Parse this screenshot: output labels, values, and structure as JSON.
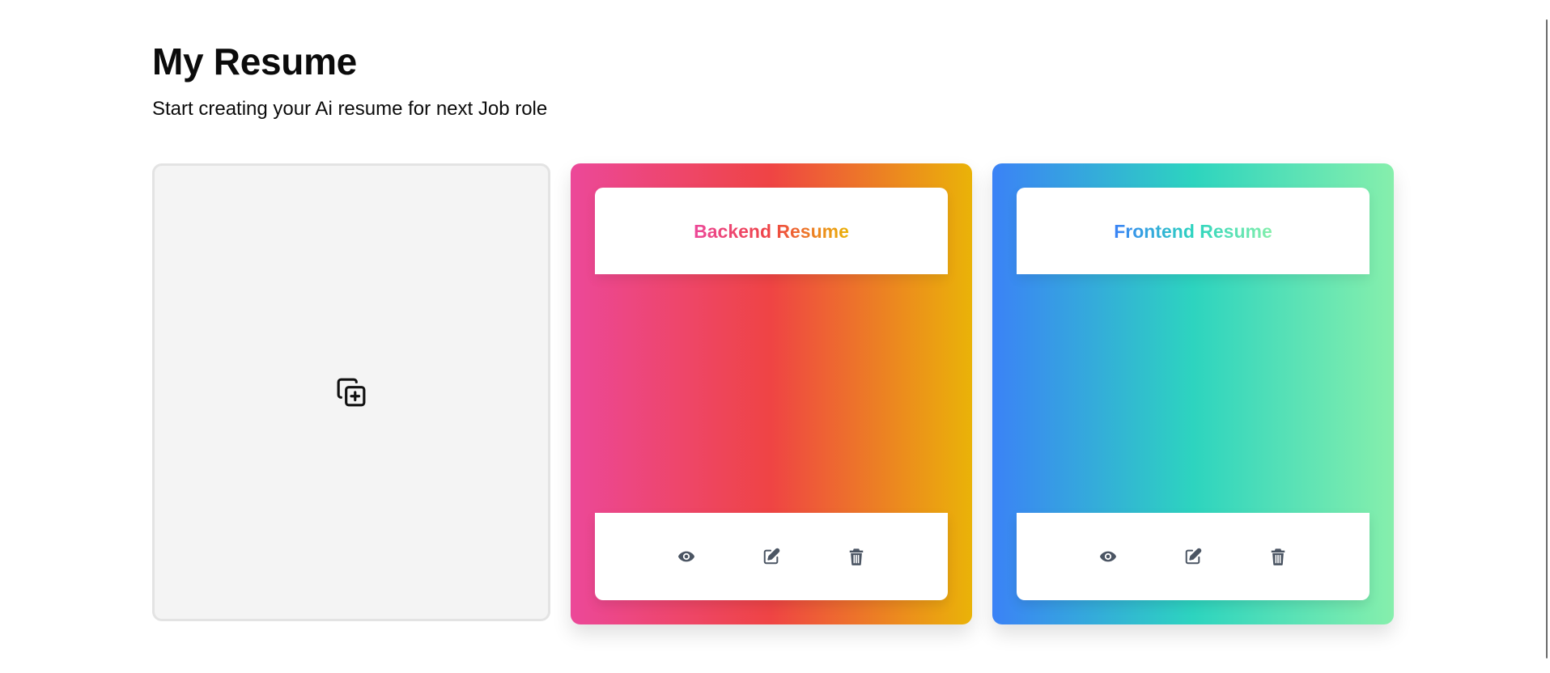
{
  "header": {
    "title": "My Resume",
    "subtitle": "Start creating your Ai resume for next Job role"
  },
  "add_card": {
    "icon": "copy-plus-icon"
  },
  "resumes": [
    {
      "title": "Backend Resume",
      "gradient": [
        "#ec4899",
        "#ef4444",
        "#eab308"
      ],
      "actions": [
        "eye-icon",
        "edit-icon",
        "trash-icon"
      ]
    },
    {
      "title": "Frontend Resume",
      "gradient": [
        "#3b82f6",
        "#2dd4bf",
        "#86efac"
      ],
      "actions": [
        "eye-icon",
        "edit-icon",
        "trash-icon"
      ]
    }
  ],
  "colors": {
    "icon": "#4b5563",
    "add_card_bg": "#f4f4f4",
    "add_card_border": "#e3e3e3"
  }
}
